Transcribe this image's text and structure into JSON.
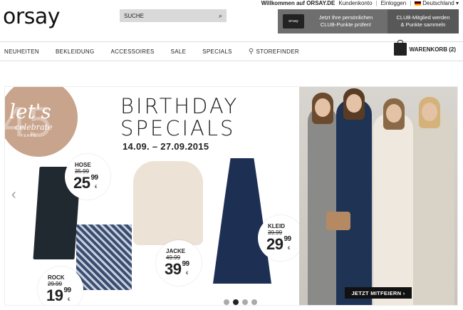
{
  "header": {
    "logo": "orsay",
    "search_placeholder": "SUCHE",
    "welcome": "Willkommen auf ORSAY.DE",
    "account": "Kundenkonto",
    "login": "Einloggen",
    "country": "Deutschland"
  },
  "club": {
    "card_text": "orsay",
    "line1": "Jetzt Ihre persönlichen",
    "line2": "CLUB-Punkte prüfen!",
    "btn_line1": "CLUB-Mitglied werden",
    "btn_line2": "& Punkte sammeln"
  },
  "nav": {
    "items": [
      "NEUHEITEN",
      "BEKLEIDUNG",
      "ACCESSOIRES",
      "SALE",
      "SPECIALS",
      "STOREFINDER"
    ],
    "cart": "WARENKORB (2)"
  },
  "banner": {
    "badge_big": "let's",
    "badge_small": "celebrate",
    "badge_num": "45",
    "badge_years": "YEARS",
    "title_line1": "BIRTHDAY",
    "title_line2": "SPECIALS",
    "dates": "14.09. – 27.09.2015",
    "prices": [
      {
        "label": "HOSE",
        "old": "35.99",
        "euros": "25",
        "cents": "99"
      },
      {
        "label": "JACKE",
        "old": "49.99",
        "euros": "39",
        "cents": "99"
      },
      {
        "label": "KLEID",
        "old": "39.99",
        "euros": "29",
        "cents": "99"
      },
      {
        "label": "ROCK",
        "old": "29.99",
        "euros": "19",
        "cents": "99"
      }
    ],
    "currency": "€",
    "cta": "JETZT MITFEIERN ›"
  },
  "carousel": {
    "count": 4,
    "active": 2
  }
}
